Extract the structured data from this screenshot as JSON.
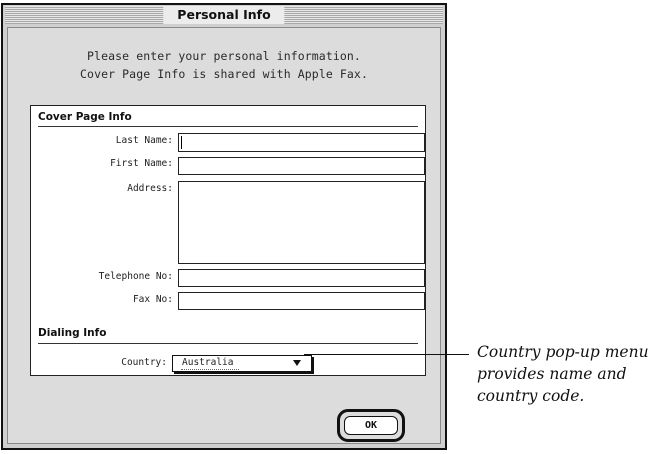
{
  "window": {
    "title": "Personal Info"
  },
  "intro": {
    "line1": "Please enter your personal information.",
    "line2": "Cover Page Info is shared with Apple Fax."
  },
  "cover_page": {
    "heading": "Cover Page Info",
    "fields": {
      "last_name": {
        "label": "Last Name:",
        "value": ""
      },
      "first_name": {
        "label": "First Name:",
        "value": ""
      },
      "address": {
        "label": "Address:",
        "value": ""
      },
      "telephone": {
        "label": "Telephone No:",
        "value": ""
      },
      "fax": {
        "label": "Fax No:",
        "value": ""
      }
    }
  },
  "dialing": {
    "heading": "Dialing Info",
    "country_label": "Country:",
    "country_value": "Australia"
  },
  "buttons": {
    "ok": "OK"
  },
  "callout": {
    "line1": "Country pop-up menu",
    "line2": "provides name and",
    "line3": "country code."
  }
}
